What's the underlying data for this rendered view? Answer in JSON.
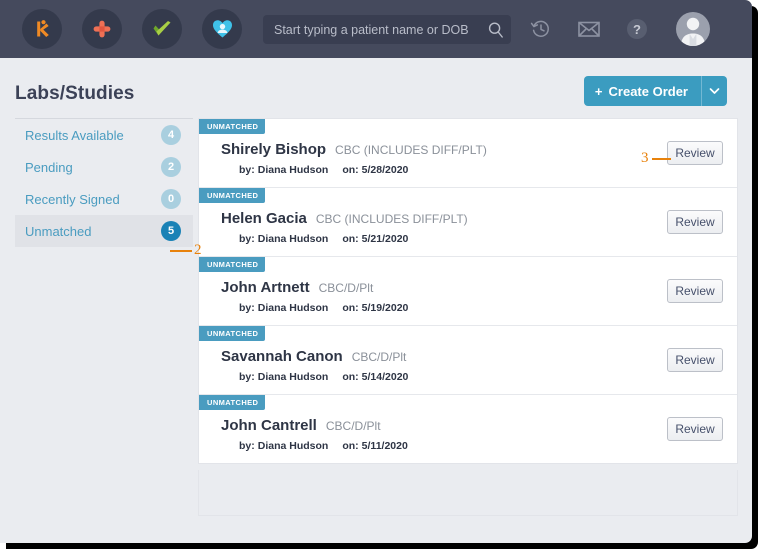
{
  "topbar": {
    "brand_icons": [
      {
        "name": "kareo-k-logo-icon",
        "label": "K"
      },
      {
        "name": "medical-cross-icon",
        "label": "cross"
      },
      {
        "name": "green-check-swoosh-icon",
        "label": "check"
      },
      {
        "name": "patient-heart-icon",
        "label": "heart"
      }
    ],
    "search": {
      "placeholder": "Start typing a patient name or DOB",
      "value": "",
      "icon": "search-icon"
    },
    "actions": [
      {
        "name": "history-icon",
        "title": "History"
      },
      {
        "name": "mail-icon",
        "title": "Messages"
      },
      {
        "name": "help-icon",
        "title": "Help"
      },
      {
        "name": "avatar",
        "title": "Account"
      }
    ]
  },
  "page": {
    "title": "Labs/Studies",
    "create_order_label": "Create Order",
    "create_order_plus": "+",
    "create_order_caret": "chevron-down-icon"
  },
  "sidebar": {
    "items": [
      {
        "label": "Results Available",
        "count": "4",
        "active": false
      },
      {
        "label": "Pending",
        "count": "2",
        "active": false
      },
      {
        "label": "Recently Signed",
        "count": "0",
        "active": false
      },
      {
        "label": "Unmatched",
        "count": "5",
        "active": true
      }
    ]
  },
  "list": {
    "review_label": "Review",
    "by_label": "by:",
    "on_label": "on:",
    "rows": [
      {
        "status": "UNMATCHED",
        "patient": "Shirely Bishop",
        "test": "CBC (INCLUDES DIFF/PLT)",
        "by": "Diana Hudson",
        "on": "5/28/2020"
      },
      {
        "status": "UNMATCHED",
        "patient": "Helen Gacia",
        "test": "CBC (INCLUDES DIFF/PLT)",
        "by": "Diana Hudson",
        "on": "5/21/2020"
      },
      {
        "status": "UNMATCHED",
        "patient": "John Artnett",
        "test": "CBC/D/Plt",
        "by": "Diana Hudson",
        "on": "5/19/2020"
      },
      {
        "status": "UNMATCHED",
        "patient": "Savannah Canon",
        "test": "CBC/D/Plt",
        "by": "Diana Hudson",
        "on": "5/14/2020"
      },
      {
        "status": "UNMATCHED",
        "patient": "John Cantrell",
        "test": "CBC/D/Plt",
        "by": "Diana Hudson",
        "on": "5/11/2020"
      }
    ]
  },
  "annotations": [
    {
      "number": "2",
      "target": "sidebar-item-unmatched"
    },
    {
      "number": "3",
      "target": "review-button-row-1"
    }
  ],
  "colors": {
    "topbar_bg": "#454a5d",
    "accent_teal": "#4a9cc0",
    "button_blue": "#3b9cc0",
    "badge_active": "#1a82b6",
    "badge_inactive": "#a9cfdf",
    "page_bg": "#eaecf0",
    "annotation_orange": "#e8820c"
  }
}
